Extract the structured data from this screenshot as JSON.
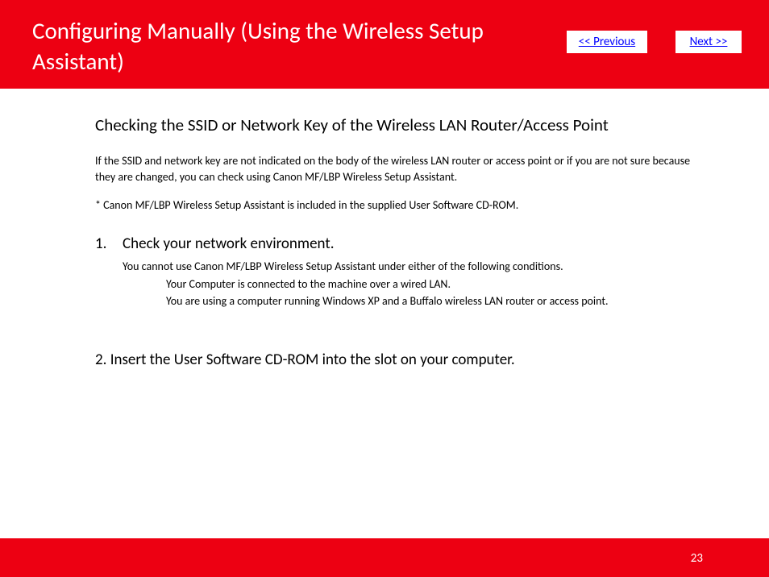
{
  "header": {
    "title": "Configuring Manually (Using the Wireless Setup Assistant)",
    "prev_label": "<< Previous",
    "next_label": "Next >>"
  },
  "section": {
    "heading": "Checking the SSID or Network Key of the Wireless LAN Router/Access Point",
    "intro": "If the SSID and network key are not indicated on the body of the wireless LAN router or access point or if you are not sure because they are changed, you can check using Canon MF/LBP Wireless Setup Assistant.",
    "note": "* Canon MF/LBP Wireless Setup Assistant is included in the supplied User Software CD-ROM."
  },
  "steps": {
    "s1": {
      "num": "1.",
      "title": "Check your network environment.",
      "body": "You cannot use Canon MF/LBP Wireless Setup Assistant under either of the following conditions.",
      "cond1": "Your Computer is connected to the machine over a wired LAN.",
      "cond2": "You are using a computer running Windows XP and a Buffalo wireless LAN router or access point."
    },
    "s2": {
      "title": "2. Insert the User Software CD-ROM into the slot on your computer."
    }
  },
  "footer": {
    "page_number": "23"
  }
}
